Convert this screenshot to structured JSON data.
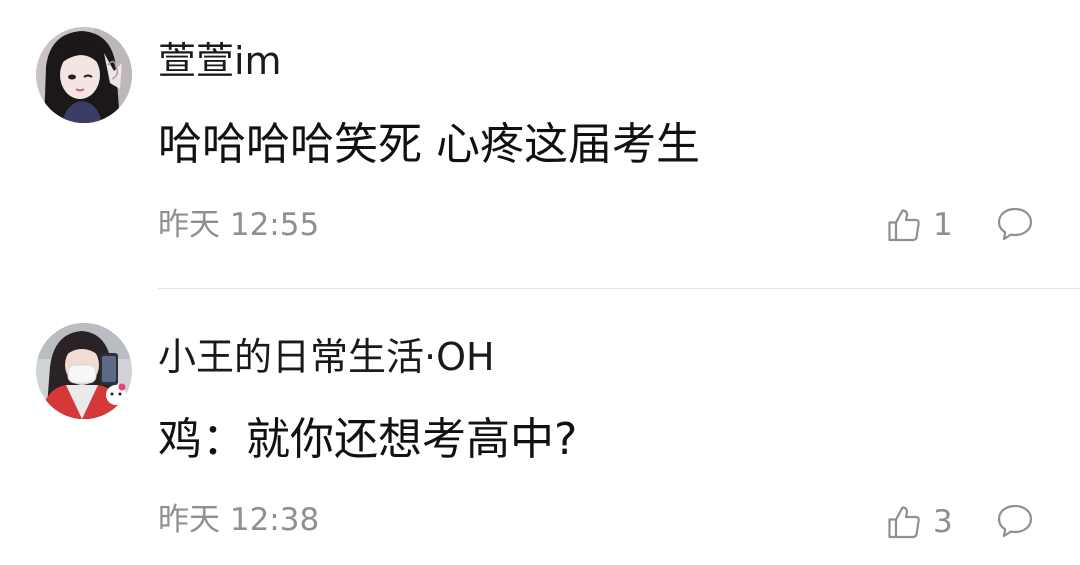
{
  "comments": [
    {
      "username": "萱萱im",
      "text": "哈哈哈哈笑死 心疼这届考生",
      "time": "昨天 12:55",
      "likes": "1",
      "avatar_icon": "avatar-girl-dark-hair-icon"
    },
    {
      "username": "小王的日常生活·OH",
      "text": "鸡：就你还想考高中?",
      "time": "昨天 12:38",
      "likes": "3",
      "avatar_icon": "avatar-girl-mask-icon"
    }
  ],
  "icons": {
    "like": "thumbs-up-icon",
    "reply": "comment-bubble-icon"
  },
  "colors": {
    "background": "#ffffff",
    "username": "#1a1a1a",
    "text": "#111111",
    "meta": "#8f8f8f",
    "divider": "#e6e6e6"
  }
}
